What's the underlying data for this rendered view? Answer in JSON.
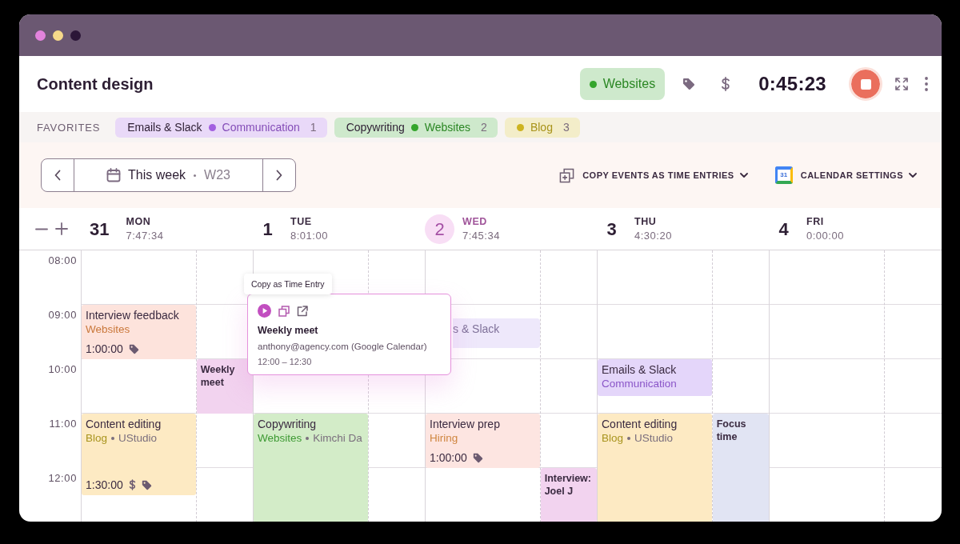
{
  "header": {
    "title": "Content design",
    "project": {
      "name": "Websites",
      "color": "#34a52c"
    },
    "timer": "0:45:23",
    "running": true
  },
  "favorites": {
    "label": "FAVORITES",
    "items": [
      {
        "task": "Emails & Slack",
        "project": "Communication",
        "color": "#a25fe0",
        "count": "1"
      },
      {
        "task": "Copywriting",
        "project": "Websites",
        "color": "#34a52c",
        "count": "2"
      },
      {
        "project": "Blog",
        "color": "#cdb320",
        "count": "3"
      }
    ]
  },
  "toolbar": {
    "range": {
      "label": "This week",
      "week": "W23"
    },
    "actions": [
      {
        "kind": "copy",
        "label": "COPY EVENTS AS TIME ENTRIES"
      },
      {
        "kind": "calendar",
        "label": "CALENDAR SETTINGS",
        "icon_text": "31"
      }
    ]
  },
  "calendar": {
    "hours": [
      "08:00",
      "09:00",
      "10:00",
      "11:00",
      "12:00"
    ],
    "days": [
      {
        "date": "31",
        "weekday": "MON",
        "total": "7:47:34",
        "today": false,
        "events": [
          {
            "kind": "wide",
            "title": "Interview feedback",
            "project": {
              "name": "Websites",
              "color": "#c9773a"
            },
            "duration": "1:00:00",
            "billable": false,
            "tagged": true,
            "color": "#fde3dc"
          },
          {
            "kind": "narrow",
            "title": "Weekly meet",
            "color": "#f2d3ef"
          },
          {
            "kind": "wide",
            "title": "Content editing",
            "project": {
              "name": "Blog",
              "color": "#a8941e"
            },
            "client": "UStudio",
            "duration": "1:30:00",
            "billable": true,
            "tagged": true,
            "color": "#fdeac3"
          }
        ]
      },
      {
        "date": "1",
        "weekday": "TUE",
        "total": "8:01:00",
        "today": false,
        "events": [
          {
            "kind": "wide",
            "title": "Copywriting",
            "project": {
              "name": "Websites",
              "color": "#3d9a33"
            },
            "client": "Kimchi Da",
            "color": "#d3ecc8"
          }
        ]
      },
      {
        "date": "2",
        "weekday": "WED",
        "total": "7:45:34",
        "today": true,
        "events": [
          {
            "kind": "wide",
            "title": "s & Slack",
            "ghost": true,
            "color": "#eee8fb"
          },
          {
            "kind": "wide",
            "title": "Interview prep",
            "project": {
              "name": "Hiring",
              "color": "#cf8640"
            },
            "duration": "1:00:00",
            "billable": false,
            "tagged": true,
            "color": "#fde5e1"
          },
          {
            "kind": "narrow",
            "title": "Interview: Joel J",
            "color": "#f2d3ef"
          }
        ]
      },
      {
        "date": "3",
        "weekday": "THU",
        "total": "4:30:20",
        "today": false,
        "events": [
          {
            "kind": "wide",
            "title": "Emails & Slack",
            "project": {
              "name": "Communication",
              "color": "#8a55c8"
            },
            "color": "#e4d6fa"
          },
          {
            "kind": "wide",
            "title": "Content editing",
            "project": {
              "name": "Blog",
              "color": "#a8941e"
            },
            "client": "UStudio",
            "color": "#fdeac3"
          },
          {
            "kind": "narrow",
            "title": "Focus time",
            "color": "#e1e4f3"
          }
        ]
      },
      {
        "date": "4",
        "weekday": "FRI",
        "total": "0:00:00",
        "today": false
      }
    ]
  },
  "event_popup": {
    "tooltip": "Copy as Time Entry",
    "title": "Weekly meet",
    "source": "anthony@agency.com (Google Calendar)",
    "time": "12:00 – 12:30"
  }
}
